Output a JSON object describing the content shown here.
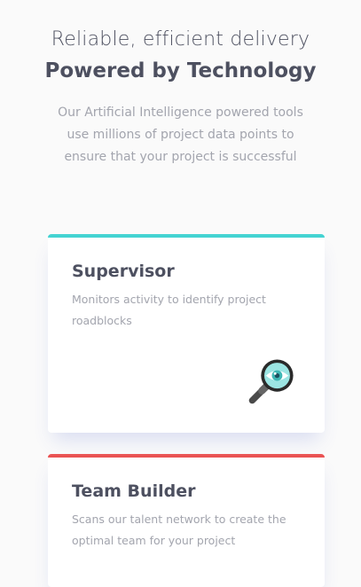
{
  "hero": {
    "subtitle": "Reliable, efficient delivery",
    "title": "Powered by Technology",
    "description": "Our Artificial Intelligence powered tools use millions of project data points to ensure that your project is successful"
  },
  "cards": [
    {
      "title": "Supervisor",
      "description": "Monitors activity to identify project roadblocks",
      "accent": "#44d3d2",
      "icon": "magnifying-glass-eye-icon"
    },
    {
      "title": "Team Builder",
      "description": "Scans our talent network to create the optimal team for your project",
      "accent": "#ea5353"
    }
  ],
  "colors": {
    "background": "#fafafa",
    "heading": "#4d5060",
    "body_text": "#a3a5ae"
  }
}
